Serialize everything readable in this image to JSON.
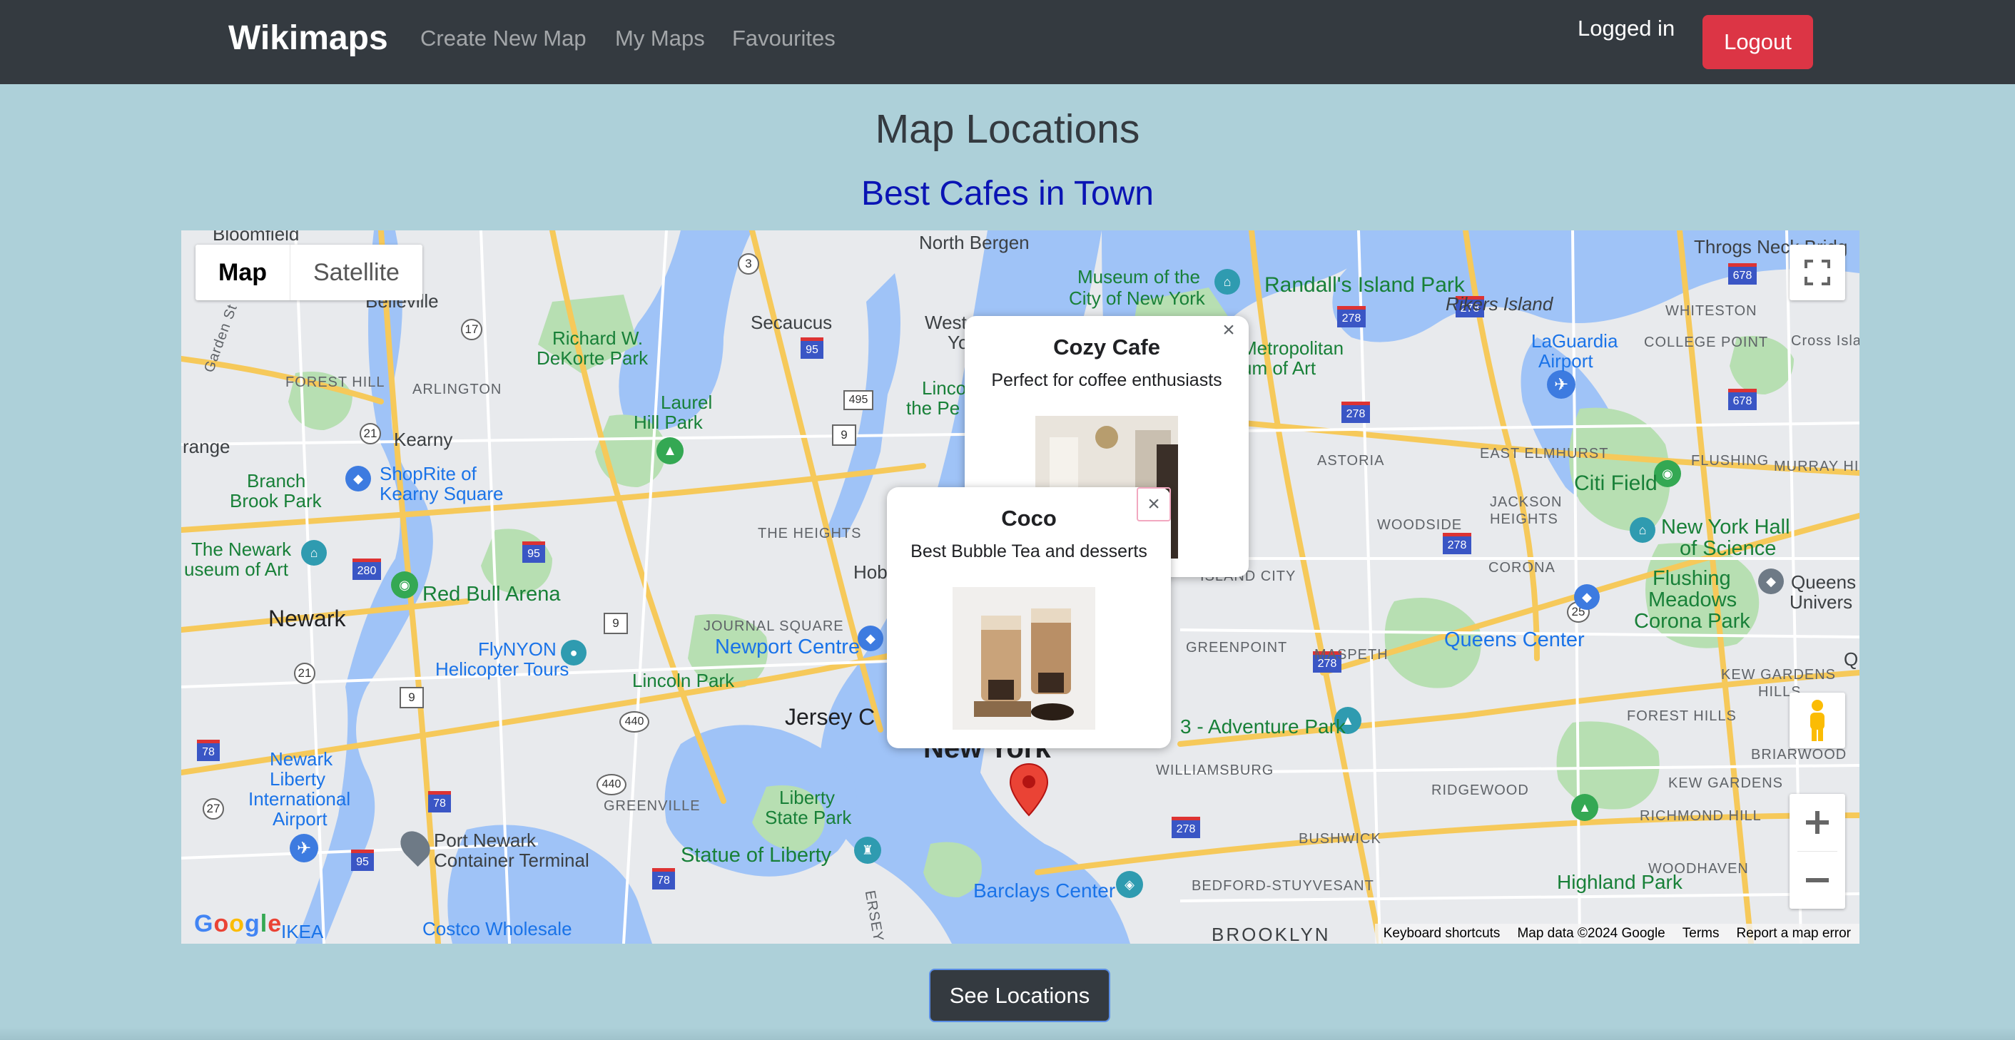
{
  "navbar": {
    "brand": "Wikimaps",
    "links": [
      "Create New Map",
      "My Maps",
      "Favourites"
    ],
    "status": "Logged in",
    "logout_label": "Logout"
  },
  "page": {
    "title": "Map Locations",
    "map_name": "Best Cafes in Town"
  },
  "map": {
    "type_options": [
      "Map",
      "Satellite"
    ],
    "selected_type": "Map",
    "labels": {
      "north_bergen": "North Bergen",
      "throgs_neck": "Throgs Neck Bridg",
      "whitestone": "WHITESTON",
      "college_point": "COLLEGE POINT",
      "cross_island": "Cross Islan",
      "belleville": "Belleville",
      "bloomfield": "Bloomfield",
      "garden_state": "Garden St",
      "secaucus": "Secaucus",
      "west": "West",
      "yo": "Yo",
      "museum_cny1": "Museum of the",
      "museum_cny2": "City of New York",
      "randalls": "Randall's Island Park",
      "rikers": "Rikers Island",
      "laguardia1": "LaGuardia",
      "laguardia2": "Airport",
      "metropolitan1": "Metropolitan",
      "metropolitan2": "um of Art",
      "richard1": "Richard W.",
      "richard2": "DeKorte Park",
      "laurel1": "Laurel",
      "laurel2": "Hill Park",
      "forest_hill": "FOREST HILL",
      "arlington": "ARLINGTON",
      "kearny": "Kearny",
      "range": "range",
      "branch1": "Branch",
      "branch2": "Brook Park",
      "shoprite1": "ShopRite of",
      "shoprite2": "Kearny Square",
      "linco": "Linco",
      "the_pe": "the Pe",
      "astoria": "ASTORIA",
      "east_elmhurst": "EAST ELMHURST",
      "flushing": "FLUSHING",
      "murray_hi": "MURRAY HI",
      "citi_field": "Citi Field",
      "jackson1": "JACKSON",
      "jackson2": "HEIGHTS",
      "woodside": "WOODSIDE",
      "nyhall1": "New York Hall",
      "nyhall2": "of Science",
      "corona": "CORONA",
      "flushing_meadows1": "Flushing",
      "flushing_meadows2": "Meadows",
      "flushing_meadows3": "Corona Park",
      "queens1": "Queens",
      "queens2": "Univers",
      "the_heights": "THE HEIGHTS",
      "newark_museum1": "The Newark",
      "newark_museum2": "useum of Art",
      "red_bull": "Red Bull Arena",
      "newark": "Newark",
      "hob": "Hob",
      "island_city": "ISLAND CITY",
      "greenpoint": "GREENPOINT",
      "queens_center": "Queens Center",
      "maspeth": "MASPETH",
      "kew_gardens1": "KEW GARDENS",
      "kew_gardens2": "HILLS",
      "journal_square": "JOURNAL SQUARE",
      "newport_centre": "Newport Centre",
      "flynyon1": "FlyNYON",
      "flynyon2": "Helicopter Tours",
      "lincoln_park": "Lincoln Park",
      "jersey_city": "Jersey C",
      "new_york": "New York",
      "adventure_park": "3 - Adventure Park",
      "forest_hills": "FOREST HILLS",
      "briarwood": "BRIARWOOD",
      "williamsburg": "WILLIAMSBURG",
      "ridgewood": "RIDGEWOOD",
      "kew_gardens": "KEW GARDENS",
      "richmond_hill": "RICHMOND HILL",
      "newark_airport1": "Newark",
      "newark_airport2": "Liberty",
      "newark_airport3": "International",
      "newark_airport4": "Airport",
      "greenville": "GREENVILLE",
      "liberty_state1": "Liberty",
      "liberty_state2": "State Park",
      "statue": "Statue of Liberty",
      "port_newark1": "Port Newark",
      "port_newark2": "Container Terminal",
      "bushwick": "BUSHWICK",
      "woodhaven": "WOODHAVEN",
      "highland": "Highland Park",
      "barclays": "Barclays Center",
      "bed_stuy": "BEDFORD-STUYVESANT",
      "brooklyn": "BROOKLYN",
      "ikea": "IKEA",
      "costco": "Costco Wholesale",
      "jersey_park": "ERSEY",
      "q": "Q"
    },
    "shields": [
      "3",
      "17",
      "95",
      "495",
      "9",
      "21",
      "280",
      "278",
      "95",
      "9",
      "21",
      "440",
      "440",
      "9",
      "78",
      "27",
      "95",
      "78",
      "78",
      "278",
      "278",
      "278",
      "278",
      "678",
      "678",
      "25",
      "278"
    ],
    "attribution": {
      "keyboard": "Keyboard shortcuts",
      "map_data": "Map data ©2024 Google",
      "terms": "Terms",
      "report": "Report a map error"
    },
    "logo": "Google"
  },
  "info_windows": [
    {
      "title": "Cozy Cafe",
      "description": "Perfect for coffee enthusiasts",
      "close": "×"
    },
    {
      "title": "Coco",
      "description": "Best Bubble Tea and desserts",
      "close": "×"
    }
  ],
  "icons": [
    "fullscreen-icon",
    "pegman-icon",
    "zoom-in-icon",
    "zoom-out-icon",
    "map-marker-icon",
    "close-icon",
    "airport-icon",
    "park-icon",
    "museum-icon",
    "shopping-icon"
  ],
  "colors": {
    "navbar": "#343a40",
    "page_bg": "#add0d9",
    "logout": "#dc3545",
    "map_name": "#0a14b4",
    "water": "#9fc3f7",
    "park": "#b7dfb2",
    "road": "#f6c95a",
    "marker": "#ea4335"
  },
  "see_locations_label": "See Locations"
}
